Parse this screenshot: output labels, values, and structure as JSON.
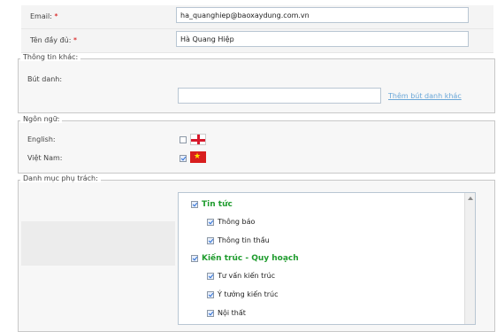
{
  "email": {
    "label": "Email:",
    "required_mark": "*",
    "value": "ha_quanghiep@baoxaydung.com.vn"
  },
  "fullname": {
    "label": "Tên đầy đủ:",
    "required_mark": "*",
    "value": "Hà Quang Hiệp"
  },
  "other_info": {
    "legend": "Thông tin khác:",
    "pen_name_label": "Bút danh:",
    "pen_name_value": "",
    "add_pen_name_link": "Thêm bút danh khác"
  },
  "language": {
    "legend": "Ngôn ngữ:",
    "options": [
      {
        "label": "English:",
        "checked": false,
        "flag": "uk-flag-icon"
      },
      {
        "label": "Việt Nam:",
        "checked": true,
        "flag": "vietnam-flag-icon"
      }
    ]
  },
  "categories": {
    "legend": "Danh mục phụ trách:",
    "items": [
      {
        "label": "Tin tức",
        "level": 0,
        "checked": true
      },
      {
        "label": "Thông báo",
        "level": 1,
        "checked": true
      },
      {
        "label": "Thông tin thầu",
        "level": 1,
        "checked": true
      },
      {
        "label": "Kiến trúc - Quy hoạch",
        "level": 0,
        "checked": true
      },
      {
        "label": "Tư vấn kiến trúc",
        "level": 1,
        "checked": true
      },
      {
        "label": "Ý tưởng kiến trúc",
        "level": 1,
        "checked": true
      },
      {
        "label": "Nội thất",
        "level": 1,
        "checked": true
      }
    ]
  },
  "colors": {
    "parent_text": "#1f9c2e",
    "link": "#6aa7d8",
    "required": "#d40000"
  }
}
